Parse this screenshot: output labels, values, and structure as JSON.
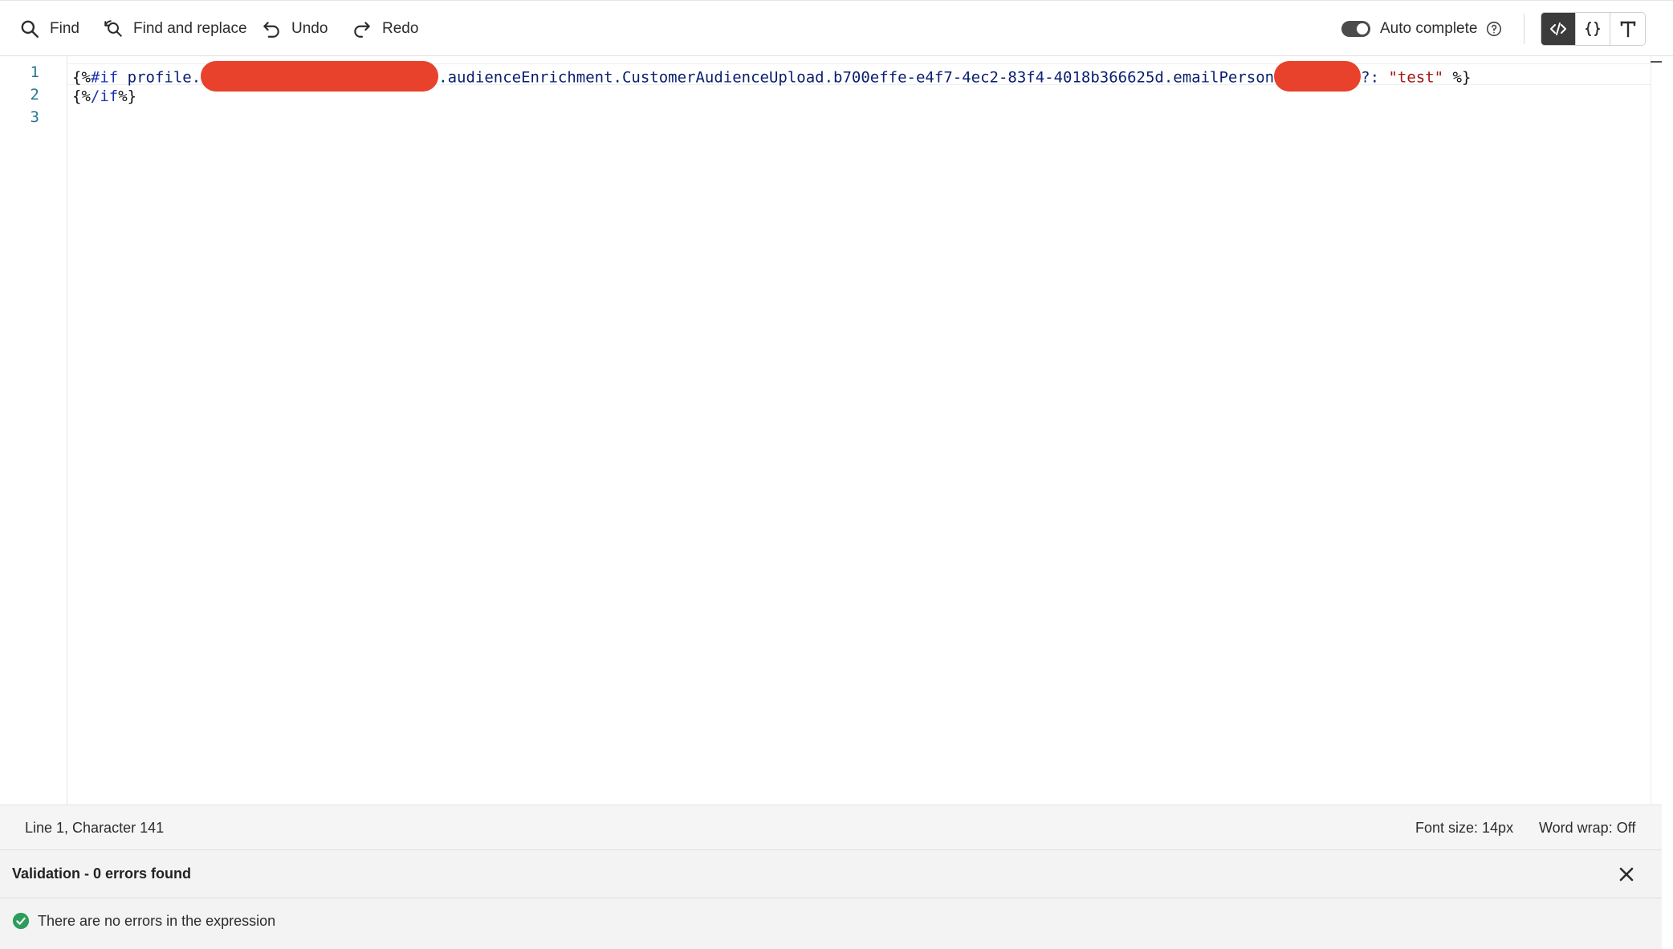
{
  "toolbar": {
    "find_label": "Find",
    "find_replace_label": "Find and replace",
    "undo_label": "Undo",
    "redo_label": "Redo",
    "autocomplete_label": "Auto complete",
    "autocomplete_enabled": true,
    "modes": [
      {
        "name": "code",
        "icon": "code-icon",
        "active": true
      },
      {
        "name": "braces",
        "icon": "braces-icon",
        "active": false
      },
      {
        "name": "text",
        "icon": "text-icon",
        "active": false
      }
    ]
  },
  "editor": {
    "line_numbers": [
      "1",
      "2",
      "3"
    ],
    "line1": {
      "open": "{%",
      "keyword": "#if",
      "prefix": " profile.",
      "middle": ".audienceEnrichment.CustomerAudienceUpload.b700effe-e4f7-4ec2-83f4-4018b366625d.emailPerson",
      "suffix": "?: ",
      "string": "\"test\"",
      "close": " %}"
    },
    "line2": {
      "open": "{%",
      "keyword": "/if",
      "close": "%}"
    },
    "redaction_color": "#e8412c"
  },
  "status": {
    "position": "Line 1, Character 141",
    "font_size": "Font size: 14px",
    "word_wrap": "Word wrap: Off"
  },
  "validation": {
    "title": "Validation - 0 errors found",
    "message": "There are no errors in the expression",
    "success_color": "#2d9d5b"
  }
}
